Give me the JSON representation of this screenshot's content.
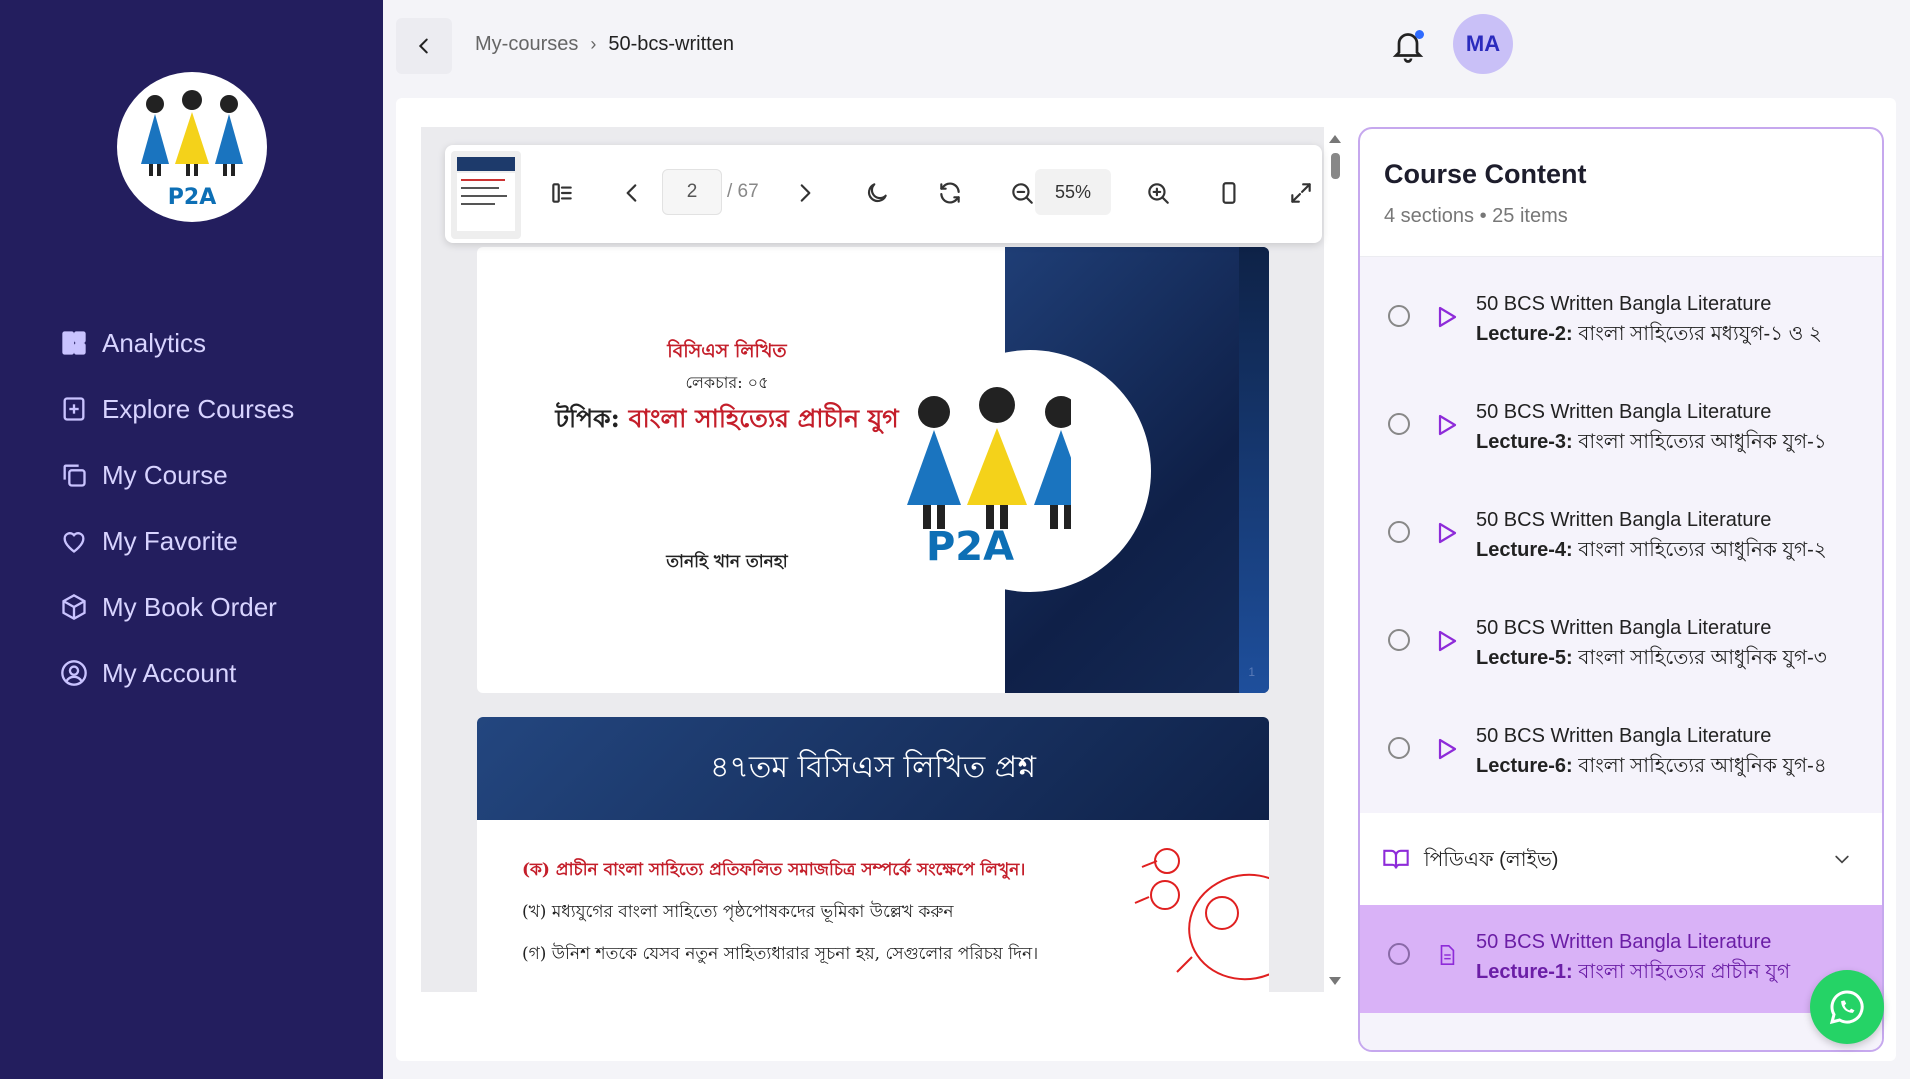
{
  "sidebar": {
    "logo_text": "P2A",
    "items": [
      {
        "label": "Analytics",
        "icon": "dashboard-icon"
      },
      {
        "label": "Explore Courses",
        "icon": "book-plus-icon"
      },
      {
        "label": "My Course",
        "icon": "copy-icon"
      },
      {
        "label": "My Favorite",
        "icon": "heart-icon"
      },
      {
        "label": "My Book Order",
        "icon": "package-icon"
      },
      {
        "label": "My Account",
        "icon": "user-circle-icon"
      }
    ]
  },
  "header": {
    "breadcrumb": [
      "My-courses",
      "50-bcs-written"
    ],
    "avatar_initials": "MA"
  },
  "viewer": {
    "current_page": "2",
    "total_pages": "/ 67",
    "zoom": "55%"
  },
  "slide1": {
    "line1": "বিসিএস লিখিত",
    "line2": "লেকচার: ০৫",
    "topic_prefix": "টপিক: ",
    "topic": "বাংলা সাহিত্যের প্রাচীন যুগ",
    "author": "তানহি খান তানহা",
    "logo_text": "P2A",
    "page_num": "1"
  },
  "slide2": {
    "title": "৪৭তম বিসিএস লিখিত প্রশ্ন",
    "q1": "(ক) প্রাচীন বাংলা সাহিত্যে প্রতিফলিত সমাজচিত্র সম্পর্কে সংক্ষেপে লিখুন।",
    "q2": "(খ) মধ্যযুগের বাংলা সাহিত্যে পৃষ্ঠপোষকদের ভূমিকা উল্লেখ করুন",
    "q3": "(গ) উনিশ শতকে যেসব নতুন সাহিত্যধারার সূচনা হয়, সেগুলোর পরিচয় দিন।"
  },
  "course": {
    "title": "Course Content",
    "subtitle": "4 sections • 25 items",
    "lessons": [
      {
        "bold": "50 BCS Written Bangla Literature",
        "prefix": "Lecture-2:",
        "rest": " বাংলা সাহিত্যের মধ্যযুগ-১ ও ২"
      },
      {
        "bold": "50 BCS Written Bangla Literature",
        "prefix": "Lecture-3:",
        "rest": " বাংলা সাহিত্যের আধুনিক যুগ-১"
      },
      {
        "bold": "50 BCS Written Bangla Literature",
        "prefix": "Lecture-4:",
        "rest": " বাংলা সাহিত্যের আধুনিক যুগ-২"
      },
      {
        "bold": "50 BCS Written Bangla Literature",
        "prefix": "Lecture-5:",
        "rest": " বাংলা সাহিত্যের আধুনিক যুগ-৩"
      },
      {
        "bold": "50 BCS Written Bangla Literature",
        "prefix": "Lecture-6:",
        "rest": " বাংলা সাহিত্যের আধুনিক যুগ-৪"
      }
    ],
    "section_label": "পিডিএফ (লাইভ)",
    "active": {
      "bold": "50 BCS Written Bangla Literature",
      "prefix": "Lecture-1:",
      "rest": " বাংলা সাহিত্যের প্রাচীন যুগ"
    }
  },
  "colors": {
    "sidebar": "#231e5e",
    "accent": "#8e2bd9",
    "active_bg": "#d9b2f7"
  }
}
